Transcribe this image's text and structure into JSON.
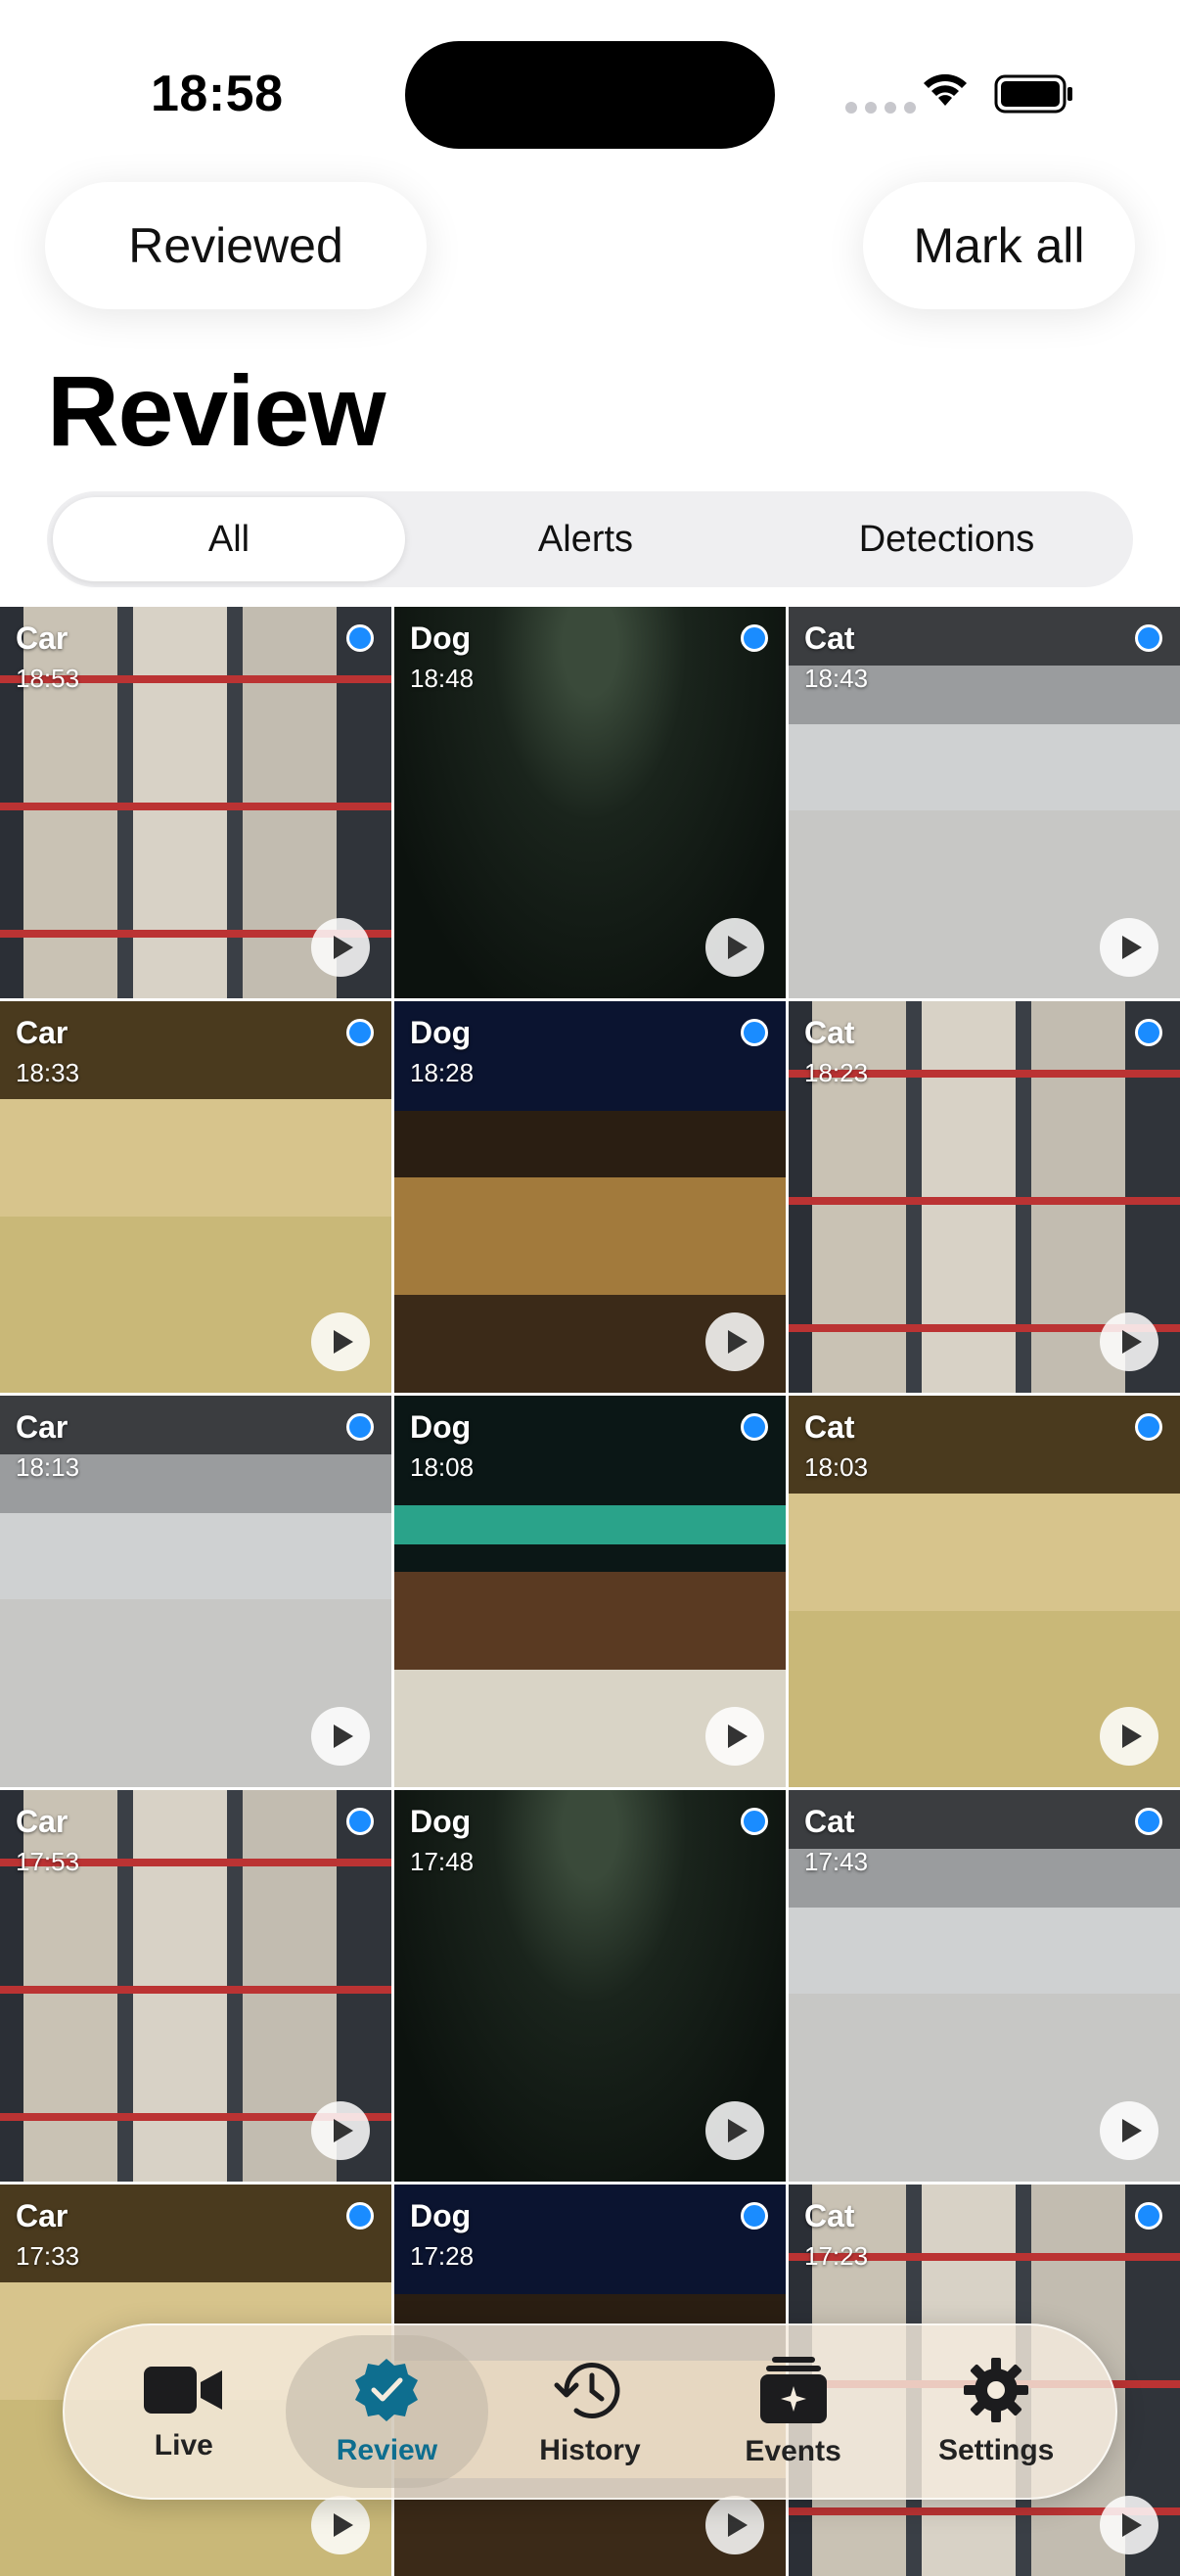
{
  "status": {
    "time": "18:58"
  },
  "header": {
    "reviewed_label": "Reviewed",
    "mark_all_label": "Mark all",
    "title": "Review"
  },
  "segments": [
    {
      "label": "All",
      "selected": true
    },
    {
      "label": "Alerts",
      "selected": false
    },
    {
      "label": "Detections",
      "selected": false
    }
  ],
  "items": [
    {
      "label": "Car",
      "time": "18:53",
      "scene": "warehouse"
    },
    {
      "label": "Dog",
      "time": "18:48",
      "scene": "park"
    },
    {
      "label": "Cat",
      "time": "18:43",
      "scene": "garage"
    },
    {
      "label": "Car",
      "time": "18:33",
      "scene": "warehouse2"
    },
    {
      "label": "Dog",
      "time": "18:28",
      "scene": "village"
    },
    {
      "label": "Cat",
      "time": "18:23",
      "scene": "warehouse"
    },
    {
      "label": "Car",
      "time": "18:13",
      "scene": "garage"
    },
    {
      "label": "Dog",
      "time": "18:08",
      "scene": "parkade"
    },
    {
      "label": "Cat",
      "time": "18:03",
      "scene": "warehouse2"
    },
    {
      "label": "Car",
      "time": "17:53",
      "scene": "warehouse"
    },
    {
      "label": "Dog",
      "time": "17:48",
      "scene": "park"
    },
    {
      "label": "Cat",
      "time": "17:43",
      "scene": "garage"
    },
    {
      "label": "Car",
      "time": "17:33",
      "scene": "warehouse2"
    },
    {
      "label": "Dog",
      "time": "17:28",
      "scene": "village"
    },
    {
      "label": "Cat",
      "time": "17:23",
      "scene": "warehouse"
    }
  ],
  "tabs": [
    {
      "label": "Live",
      "icon": "video-camera-icon",
      "selected": false
    },
    {
      "label": "Review",
      "icon": "checkmark-seal-icon",
      "selected": true
    },
    {
      "label": "History",
      "icon": "clock-history-icon",
      "selected": false
    },
    {
      "label": "Events",
      "icon": "sparkles-stack-icon",
      "selected": false
    },
    {
      "label": "Settings",
      "icon": "gear-icon",
      "selected": false
    }
  ],
  "colors": {
    "unreviewed_dot": "#1a8cff",
    "active_tab": "#0e6e8f"
  }
}
